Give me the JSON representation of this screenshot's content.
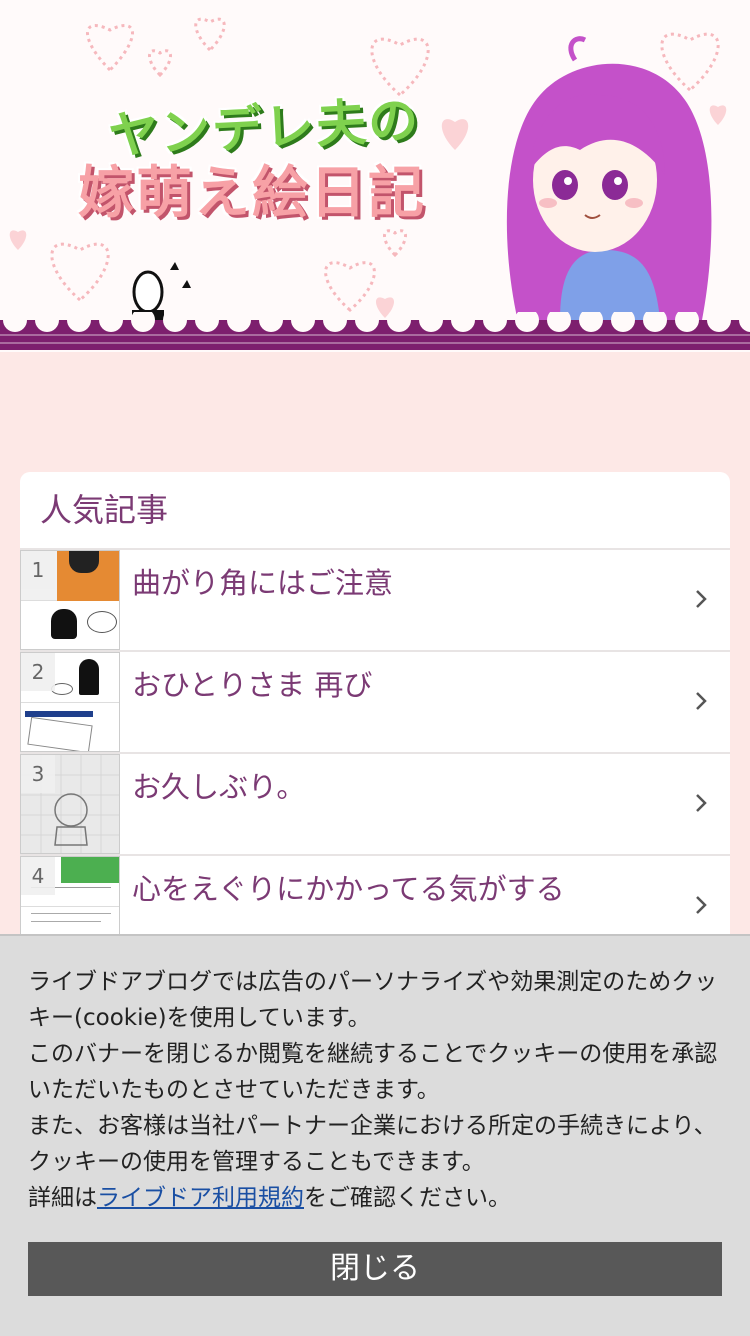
{
  "header": {
    "title_line1": "ヤンデレ夫の",
    "title_line2": "嫁萌え絵日記"
  },
  "popular": {
    "heading": "人気記事",
    "articles": [
      {
        "rank": "1",
        "title": "曲がり角にはご注意"
      },
      {
        "rank": "2",
        "title": "おひとりさま 再び"
      },
      {
        "rank": "3",
        "title": "お久しぶり。"
      },
      {
        "rank": "4",
        "title": "心をえぐりにかかってる気がする"
      }
    ]
  },
  "cookie_banner": {
    "line1": "ライブドアブログでは広告のパーソナライズや効果測定のためクッキー(cookie)を使用しています。",
    "line2": "このバナーを閉じるか閲覧を継続することでクッキーの使用を承認いただいたものとさせていただきます。",
    "line3": "また、お客様は当社パートナー企業における所定の手続きにより、クッキーの使用を管理することもできます。",
    "line4_prefix": "詳細は",
    "terms_link": "ライブドア利用規約",
    "line4_suffix": "をご確認ください。",
    "close_label": "閉じる"
  },
  "colors": {
    "accent": "#7b3a74",
    "background": "#fde8e6",
    "close_button": "#585858",
    "link": "#1a4fa3"
  }
}
